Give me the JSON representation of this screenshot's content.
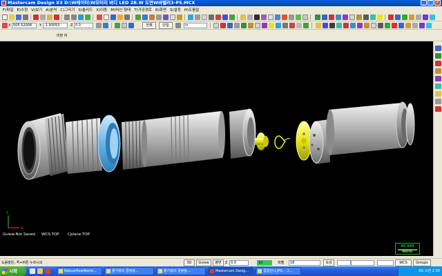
{
  "window": {
    "title": "Mastercam Design X3  D:\\W레이터\\W모터리 바디 LED 2B.W 도면W바텔러3-P5.MCX"
  },
  "menu": {
    "items": [
      "F)파일",
      "E)수정",
      "V)보기",
      "A)분석",
      "C)그리기",
      "S)솔리드",
      "X)이동",
      "M)머신 형태",
      "T)가공경로",
      "R)화면",
      "S)설정",
      "H)도움말"
    ]
  },
  "toolbar2": {
    "x_value": "505.52008",
    "y_value": "-1.93053",
    "z_value": "0.0",
    "btn_all": "전체",
    "btn_single": "단일",
    "unit_value": "in"
  },
  "toolbar3": {
    "label": "리본 바"
  },
  "viewport": {
    "gview": "Gview:Not Saved",
    "wcs": "WCS:TOP",
    "cplane": "Cplane:TOP",
    "axis_y": "Y",
    "axis_x": "X"
  },
  "metric": {
    "value": "40.949",
    "unit": "Metric"
  },
  "status": {
    "prompt": "도움말은, 꾹+버튼 누르시오",
    "mode_3d": "3D",
    "gview": "Gview",
    "plane": "평면",
    "z_label": "Z",
    "z_value": "0.0",
    "color_value": "10",
    "level_label": "레벨",
    "level_value": "18",
    "attr": "속성",
    "wcs": "WCS",
    "groups": "Groups"
  },
  "taskbar": {
    "start": "시작",
    "buttons": [
      "RobustflowWorld...",
      "물가흡의 결정을...",
      "물가흡의 결정을...",
      "Mastercam Desig...",
      "결합전니.JPG - 그..."
    ],
    "clock": "오전 2:30",
    "lang": "KO"
  },
  "colors": {
    "viewport_bg": "#000000",
    "titlebar": "#0a5fd6",
    "taskbar": "#245edb",
    "highlight_part": "#6bb6e6",
    "yellow_part": "#e6e615"
  }
}
